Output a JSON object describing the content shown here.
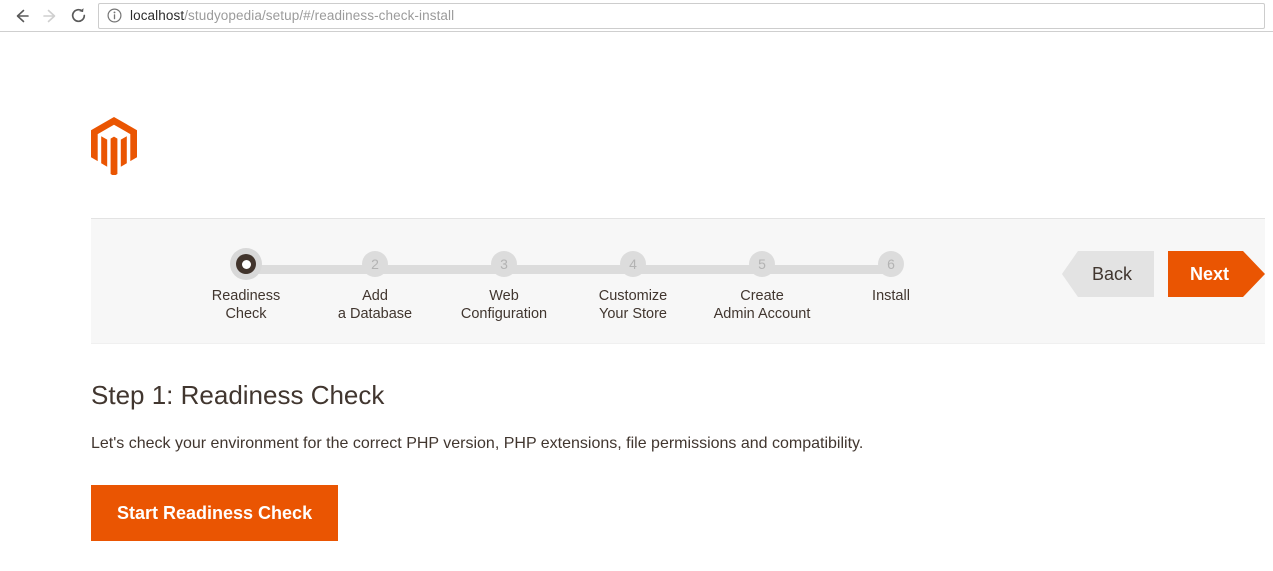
{
  "browser": {
    "back_icon": "arrow-left-icon",
    "forward_icon": "arrow-right-icon",
    "reload_icon": "reload-icon",
    "info_icon": "info-circle-icon",
    "url_host": "localhost",
    "url_path": "/studyopedia/setup/#/readiness-check-install"
  },
  "brand": {
    "logo_icon": "magento-logo-icon",
    "accent_color": "#ea5502"
  },
  "stepper": {
    "steps": [
      {
        "number": "1",
        "label": "Readiness\nCheck",
        "state": "active"
      },
      {
        "number": "2",
        "label": "Add\na Database",
        "state": "inactive"
      },
      {
        "number": "3",
        "label": "Web\nConfiguration",
        "state": "inactive"
      },
      {
        "number": "4",
        "label": "Customize\nYour Store",
        "state": "inactive"
      },
      {
        "number": "5",
        "label": "Create\nAdmin Account",
        "state": "inactive"
      },
      {
        "number": "6",
        "label": "Install",
        "state": "inactive"
      }
    ],
    "back_label": "Back",
    "next_label": "Next"
  },
  "main": {
    "title": "Step 1: Readiness Check",
    "description": "Let's check your environment for the correct PHP version, PHP extensions, file permissions and compatibility.",
    "primary_button": "Start Readiness Check"
  }
}
